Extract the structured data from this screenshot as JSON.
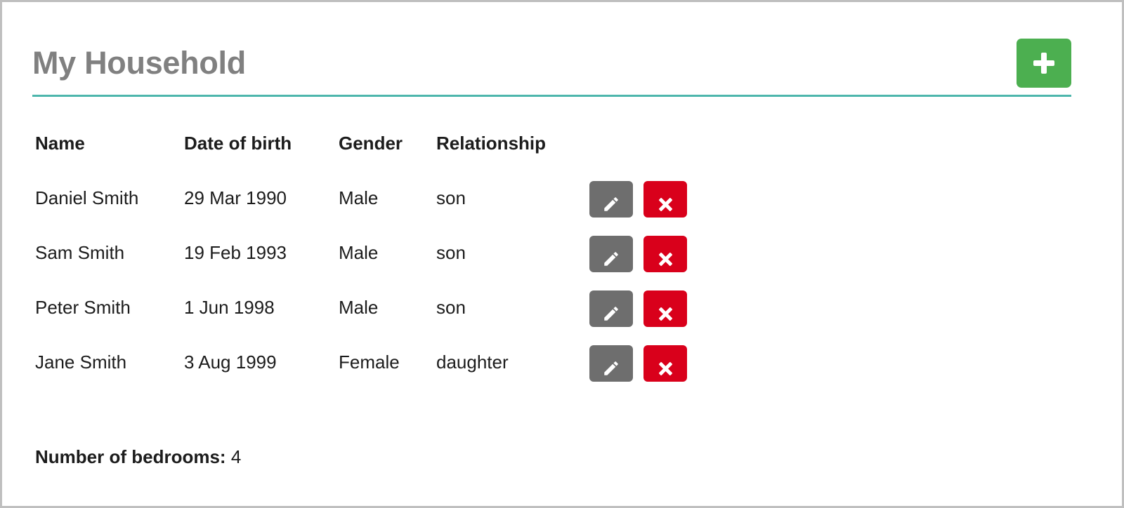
{
  "header": {
    "title": "My Household",
    "add_button_label": "+",
    "add_button_icon": "plus-icon",
    "accent_rule_color": "#4db6ac",
    "add_button_color": "#4caf50",
    "title_color": "#808080"
  },
  "table": {
    "columns": [
      {
        "key": "name",
        "label": "Name"
      },
      {
        "key": "dob",
        "label": "Date of birth"
      },
      {
        "key": "gender",
        "label": "Gender"
      },
      {
        "key": "relationship",
        "label": "Relationship"
      },
      {
        "key": "actions",
        "label": ""
      }
    ],
    "rows": [
      {
        "name": "Daniel Smith",
        "dob": "29 Mar 1990",
        "gender": "Male",
        "relationship": "son",
        "edit_icon": "pencil-icon",
        "delete_icon": "close-icon"
      },
      {
        "name": "Sam Smith",
        "dob": "19 Feb 1993",
        "gender": "Male",
        "relationship": "son",
        "edit_icon": "pencil-icon",
        "delete_icon": "close-icon"
      },
      {
        "name": "Peter Smith",
        "dob": "1 Jun 1998",
        "gender": "Male",
        "relationship": "son",
        "edit_icon": "pencil-icon",
        "delete_icon": "close-icon"
      },
      {
        "name": "Jane Smith",
        "dob": "3 Aug 1999",
        "gender": "Female",
        "relationship": "daughter",
        "edit_icon": "pencil-icon",
        "delete_icon": "close-icon"
      }
    ],
    "edit_button_color": "#6e6e6e",
    "delete_button_color": "#d9001b"
  },
  "footer": {
    "bedrooms_label": "Number of bedrooms:",
    "bedrooms_value": "4"
  }
}
